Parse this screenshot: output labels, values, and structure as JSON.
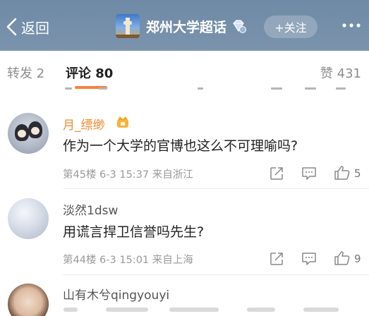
{
  "nav": {
    "back_label": "返回",
    "topic_title": "郑州大学超话",
    "follow_label": "+关注"
  },
  "tabs": {
    "reposts": "转发 2",
    "comments": "评论 80",
    "likes": "赞 431"
  },
  "comments": [
    {
      "username": "月_缥缈",
      "text": "作为一个大学的官博也这么不可理喻吗?",
      "meta": "第45楼 6-3 15:37 来自浙江",
      "likes": "5"
    },
    {
      "username": "淡然1dsw",
      "text": "用谎言捍卫信誉吗先生?",
      "meta": "第44楼 6-3 15:01 来自上海",
      "likes": "9"
    },
    {
      "username": "山有木兮qingyouyi"
    }
  ],
  "colors": {
    "nav_bg": "#7a92ad",
    "accent_orange": "#f7813b",
    "username_orange": "#f08a2c"
  },
  "icons": [
    "chevron-left-icon",
    "diamond-icon",
    "more-icon",
    "vip-crown-icon",
    "share-icon",
    "comment-icon",
    "thumb-up-icon"
  ]
}
